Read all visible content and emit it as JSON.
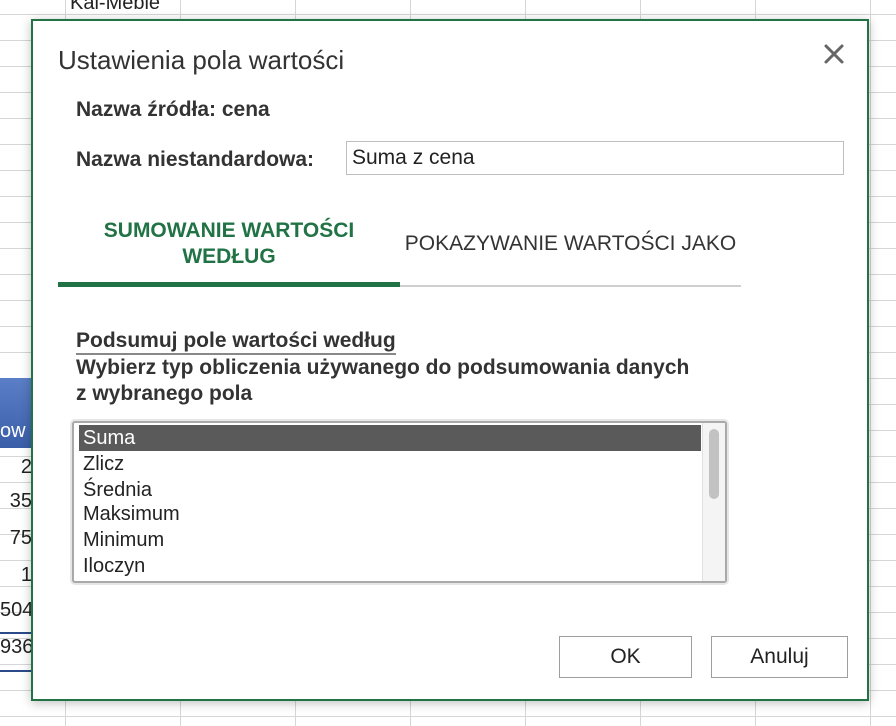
{
  "spreadsheet": {
    "top_cell_text": "Kal-Meble",
    "header_partial": "ow",
    "row_values": [
      "2",
      "35",
      "75",
      "1",
      "504",
      "936"
    ]
  },
  "dialog": {
    "title": "Ustawienia pola wartości",
    "source_name_label": "Nazwa źródła: cena",
    "custom_name_label": "Nazwa niestandardowa:",
    "custom_name_value": "Suma z cena",
    "tabs": [
      {
        "label": "SUMOWANIE WARTOŚCI WEDŁUG",
        "active": true
      },
      {
        "label": "POKAZYWANIE WARTOŚCI JAKO",
        "active": false
      }
    ],
    "section_heading": "Podsumuj pole wartości według",
    "section_description": "Wybierz typ obliczenia używanego do podsumowania danych z wybranego pola",
    "functions": [
      "Suma",
      "Zlicz",
      "Średnia",
      "Maksimum",
      "Minimum",
      "Iloczyn"
    ],
    "selected_function": "Suma",
    "ok_label": "OK",
    "cancel_label": "Anuluj"
  },
  "colors": {
    "accent": "#217346",
    "selection": "#5a5a5a",
    "header_blue": "#3a5ea8"
  },
  "icons": {
    "close": "close-icon"
  }
}
